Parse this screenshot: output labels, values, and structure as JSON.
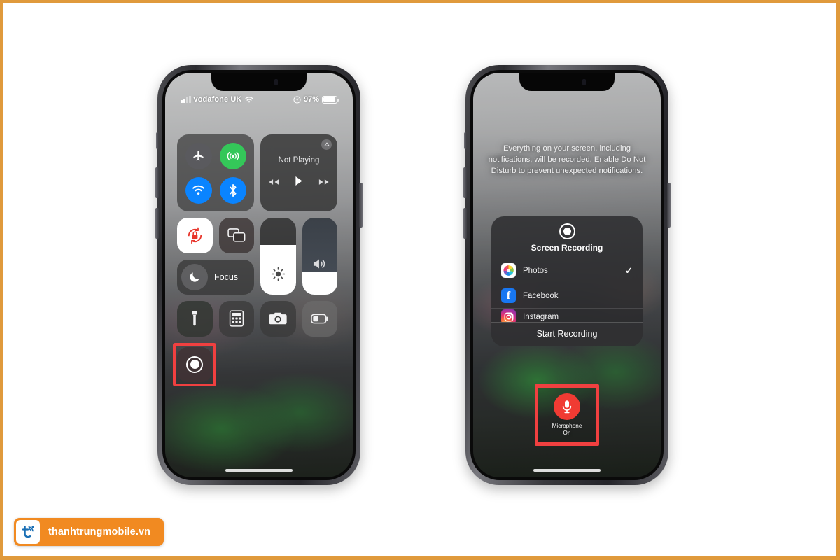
{
  "page": {
    "border_color": "#e09a3c",
    "background": "#ffffff"
  },
  "watermark": {
    "brand": "thanhtrungmobile.vn",
    "logo_icon": "t-signal-logo-icon",
    "badge_color": "#f18a21"
  },
  "phone_left": {
    "label": "iphone-control-center",
    "status_bar": {
      "signal_icon": "cellular-signal-icon",
      "carrier": "vodafone UK",
      "wifi_icon": "wifi-icon",
      "location_icon": "location-arrow-icon",
      "battery_percent": "97%",
      "battery_icon": "battery-full-icon"
    },
    "control_center": {
      "connectivity": [
        {
          "name": "airplane-mode",
          "icon": "airplane-icon",
          "state": "off",
          "color": "#5a5a5e"
        },
        {
          "name": "cellular-data",
          "icon": "cellular-tower-icon",
          "state": "on",
          "color": "#34c759"
        },
        {
          "name": "wifi",
          "icon": "wifi-icon",
          "state": "on",
          "color": "#0a84ff"
        },
        {
          "name": "bluetooth",
          "icon": "bluetooth-icon",
          "state": "on",
          "color": "#0a84ff"
        }
      ],
      "media": {
        "title": "Not Playing",
        "airplay_icon": "airplay-icon",
        "controls": [
          "rewind-icon",
          "play-icon",
          "fast-forward-icon"
        ]
      },
      "rotation_lock": {
        "icon": "rotation-lock-icon",
        "state": "on"
      },
      "screen_mirroring": {
        "icon": "screen-mirroring-icon"
      },
      "focus": {
        "label": "Focus",
        "icon": "moon-icon"
      },
      "brightness": {
        "icon": "brightness-icon",
        "level": 65
      },
      "volume": {
        "icon": "speaker-icon",
        "level": 30
      },
      "bottom_row": [
        {
          "name": "flashlight",
          "icon": "flashlight-icon"
        },
        {
          "name": "calculator",
          "icon": "calculator-icon"
        },
        {
          "name": "camera",
          "icon": "camera-icon"
        },
        {
          "name": "low-power-mode",
          "icon": "battery-low-icon"
        }
      ],
      "screen_record": {
        "name": "screen-record-button",
        "icon": "record-circle-icon",
        "highlighted": true,
        "highlight_color": "#f04040"
      }
    }
  },
  "phone_right": {
    "label": "iphone-screen-recording-options",
    "notice": "Everything on your screen, including notifications, will be recorded. Enable Do Not Disturb to prevent unexpected notifications.",
    "sheet": {
      "icon": "record-circle-icon",
      "title": "Screen Recording",
      "destinations": [
        {
          "app": "Photos",
          "icon": "photos-app-icon",
          "selected": true,
          "check": "✓"
        },
        {
          "app": "Facebook",
          "icon": "facebook-app-icon",
          "selected": false,
          "check": ""
        },
        {
          "app": "Instagram",
          "icon": "instagram-app-icon",
          "selected": false,
          "check": ""
        }
      ],
      "action_label": "Start Recording"
    },
    "microphone": {
      "icon": "microphone-icon",
      "label_line1": "Microphone",
      "label_line2": "On",
      "state": "On",
      "button_color": "#f03b33",
      "highlighted": true,
      "highlight_color": "#f04040"
    }
  }
}
